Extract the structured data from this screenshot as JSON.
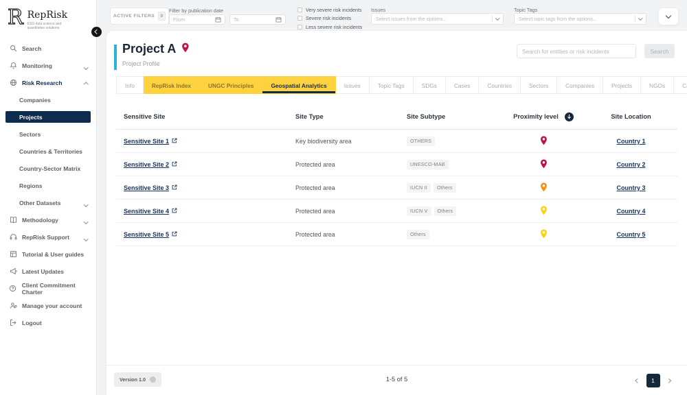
{
  "colors": {
    "navy": "#15293e",
    "yellow": "#fdd23e",
    "cyan": "#2ab5d6",
    "pin_red": "#c11346",
    "pin_orange": "#f0930f",
    "pin_yellow": "#ffd10e"
  },
  "sidebar": {
    "logo_letter": "R",
    "brand": "RepRisk",
    "tagline": "ESG data science and quantitative solutions",
    "items": [
      {
        "label": "Search",
        "icon": "search-icon"
      },
      {
        "label": "Monitoring",
        "icon": "bell-icon",
        "chevron": "down"
      },
      {
        "label": "Risk Research",
        "icon": "globe-icon",
        "chevron": "up",
        "emphasis": true
      },
      {
        "label": "Companies",
        "indent": true
      },
      {
        "label": "Projects",
        "indent": true,
        "active": true
      },
      {
        "label": "Sectors",
        "indent": true
      },
      {
        "label": "Countries & Territories",
        "indent": true
      },
      {
        "label": "Country-Sector Matrix",
        "indent": true
      },
      {
        "label": "Regions",
        "indent": true
      },
      {
        "label": "Other Datasets",
        "indent": true,
        "chevron": "down"
      },
      {
        "label": "Methodology",
        "icon": "book-icon",
        "chevron": "down"
      },
      {
        "label": "RepRisk Support",
        "icon": "headset-icon",
        "chevron": "down"
      },
      {
        "label": "Tutorial & User guides",
        "icon": "grid-icon"
      },
      {
        "label": "Latest Updates",
        "icon": "megaphone-icon"
      },
      {
        "label": "Client Commitment Charter",
        "icon": "question-icon"
      },
      {
        "label": "Manage your account",
        "icon": "user-icon"
      },
      {
        "label": "Logout",
        "icon": "logout-icon"
      }
    ]
  },
  "filter_bar": {
    "active_filters_label": "ACTIVE FILTERS",
    "active_filters_count": "0",
    "date_label": "Filter by publication date",
    "from_placeholder": "From",
    "to_placeholder": "To",
    "checkboxes": [
      "Very severe risk incidents",
      "Severe risk incidents",
      "Less severe risk incidents"
    ],
    "issues_label": "Issues",
    "issues_placeholder": "Select issues from the options...",
    "topic_tags_label": "Topic Tags",
    "topic_tags_placeholder": "Select topic tags from the options..."
  },
  "page": {
    "title": "Project A",
    "subtitle": "Project Profile",
    "search_placeholder": "Search for entities or risk incidents",
    "search_button": "Search"
  },
  "tabs": {
    "add_button_glyph": "+",
    "items": [
      {
        "label": "Info"
      },
      {
        "label": "RepRisk Index",
        "highlight": true
      },
      {
        "label": "UNGC Principles",
        "highlight": true
      },
      {
        "label": "Geospatial Analytics",
        "highlight": true,
        "active": true
      },
      {
        "label": "Issues"
      },
      {
        "label": "Topic Tags"
      },
      {
        "label": "SDGs"
      },
      {
        "label": "Cases"
      },
      {
        "label": "Countries"
      },
      {
        "label": "Sectors"
      },
      {
        "label": "Companies"
      },
      {
        "label": "Projects"
      },
      {
        "label": "NGOs"
      },
      {
        "label": "Campaigns"
      }
    ]
  },
  "table": {
    "columns": [
      "Sensitive Site",
      "Site Type",
      "Site Subtype",
      "Proximity level",
      "Site Location"
    ],
    "sort_column": "Proximity level",
    "rows": [
      {
        "site": "Sensitive Site 1",
        "type": "Key biodiversity area",
        "subtypes": [
          "OTHERS"
        ],
        "proximity": "high",
        "location": "Country 1"
      },
      {
        "site": "Sensitive Site 2",
        "type": "Protected area",
        "subtypes": [
          "UNESCO-MAB"
        ],
        "proximity": "high",
        "location": "Country 2"
      },
      {
        "site": "Sensitive Site 3",
        "type": "Protected area",
        "subtypes": [
          "IUCN II",
          "Others"
        ],
        "proximity": "medium",
        "location": "Country 3"
      },
      {
        "site": "Sensitive Site 4",
        "type": "Protected area",
        "subtypes": [
          "IUCN V",
          "Others"
        ],
        "proximity": "low",
        "location": "Country 4"
      },
      {
        "site": "Sensitive Site 5",
        "type": "Protected area",
        "subtypes": [
          "Others"
        ],
        "proximity": "low",
        "location": "Country 5"
      }
    ]
  },
  "footer": {
    "version": "Version 1.0",
    "range_text": "1-5 of 5",
    "current_page": "1"
  }
}
